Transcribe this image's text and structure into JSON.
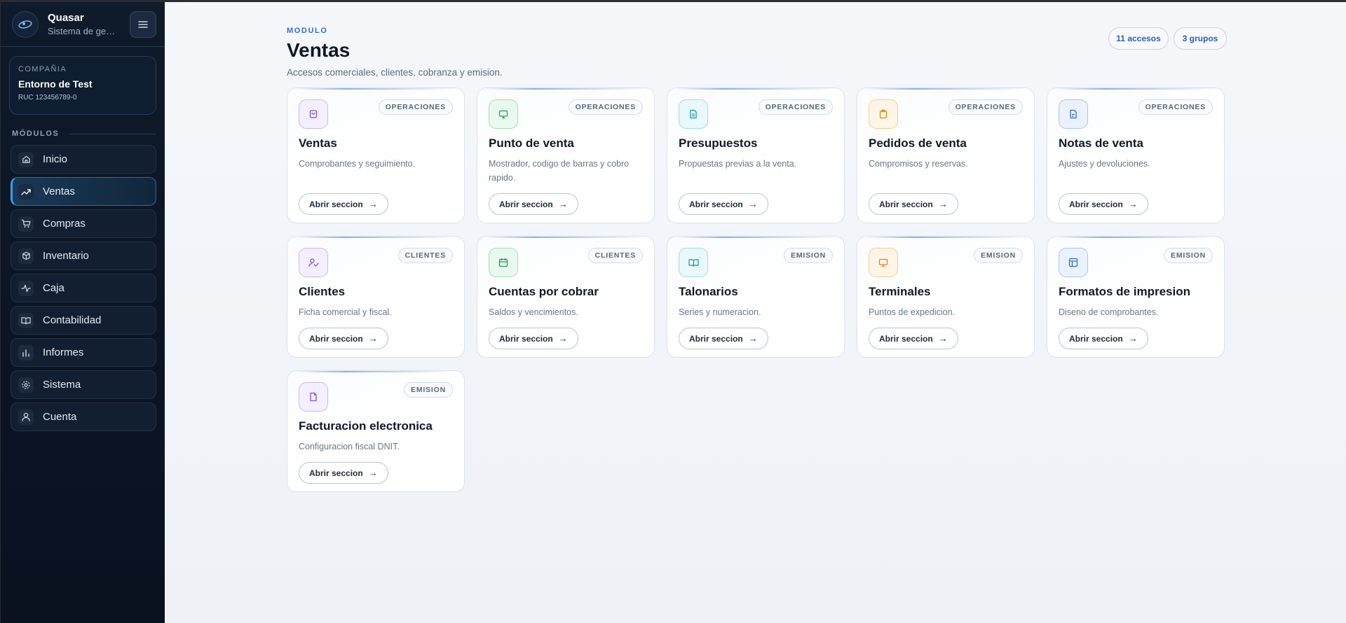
{
  "app": {
    "name": "Quasar",
    "subtitle": "Sistema de gestion"
  },
  "company": {
    "label": "COMPAÑIA",
    "name": "Entorno de Test",
    "ruc": "RUC 123456789-0"
  },
  "sidebar": {
    "section_label": "MÓDULOS",
    "items": [
      {
        "label": "Inicio",
        "icon": "home-icon"
      },
      {
        "label": "Ventas",
        "icon": "trending-up-icon"
      },
      {
        "label": "Compras",
        "icon": "cart-icon"
      },
      {
        "label": "Inventario",
        "icon": "box-icon"
      },
      {
        "label": "Caja",
        "icon": "activity-icon"
      },
      {
        "label": "Contabilidad",
        "icon": "book-icon"
      },
      {
        "label": "Informes",
        "icon": "bar-chart-icon"
      },
      {
        "label": "Sistema",
        "icon": "gear-icon"
      },
      {
        "label": "Cuenta",
        "icon": "user-icon"
      }
    ],
    "active_index": 1
  },
  "header": {
    "kicker": "MODULO",
    "title": "Ventas",
    "subtitle": "Accesos comerciales, clientes, cobranza y emision.",
    "pills": [
      "11 accesos",
      "3 grupos"
    ]
  },
  "cards": [
    {
      "title": "Ventas",
      "desc": "Comprobantes y seguimiento.",
      "badge": "OPERACIONES",
      "button": "Abrir seccion",
      "icon": "shopping-bag-icon",
      "color": "violet"
    },
    {
      "title": "Punto de venta",
      "desc": "Mostrador, codigo de barras y cobro rapido.",
      "badge": "OPERACIONES",
      "button": "Abrir seccion",
      "icon": "monitor-icon",
      "color": "green"
    },
    {
      "title": "Presupuestos",
      "desc": "Propuestas previas a la venta.",
      "badge": "OPERACIONES",
      "button": "Abrir seccion",
      "icon": "document-icon",
      "color": "cyan"
    },
    {
      "title": "Pedidos de venta",
      "desc": "Compromisos y reservas.",
      "badge": "OPERACIONES",
      "button": "Abrir seccion",
      "icon": "clipboard-icon",
      "color": "amber"
    },
    {
      "title": "Notas de venta",
      "desc": "Ajustes y devoluciones.",
      "badge": "OPERACIONES",
      "button": "Abrir seccion",
      "icon": "file-text-icon",
      "color": "blue"
    },
    {
      "title": "Clientes",
      "desc": "Ficha comercial y fiscal.",
      "badge": "CLIENTES",
      "button": "Abrir seccion",
      "icon": "user-check-icon",
      "color": "violet"
    },
    {
      "title": "Cuentas por cobrar",
      "desc": "Saldos y vencimientos.",
      "badge": "CLIENTES",
      "button": "Abrir seccion",
      "icon": "calendar-icon",
      "color": "green"
    },
    {
      "title": "Talonarios",
      "desc": "Series y numeracion.",
      "badge": "EMISION",
      "button": "Abrir seccion",
      "icon": "open-book-icon",
      "color": "cyan"
    },
    {
      "title": "Terminales",
      "desc": "Puntos de expedicion.",
      "badge": "EMISION",
      "button": "Abrir seccion",
      "icon": "monitor-icon",
      "color": "amber"
    },
    {
      "title": "Formatos de impresion",
      "desc": "Diseno de comprobantes.",
      "badge": "EMISION",
      "button": "Abrir seccion",
      "icon": "layout-icon",
      "color": "blue"
    },
    {
      "title": "Facturacion electronica",
      "desc": "Configuracion fiscal DNIT.",
      "badge": "EMISION",
      "button": "Abrir seccion",
      "icon": "file-icon",
      "color": "violet"
    }
  ],
  "colors": {
    "accent": "#2f6fd6",
    "sidebar_bg": "#0b1524",
    "active_border": "#3aa0e4"
  }
}
